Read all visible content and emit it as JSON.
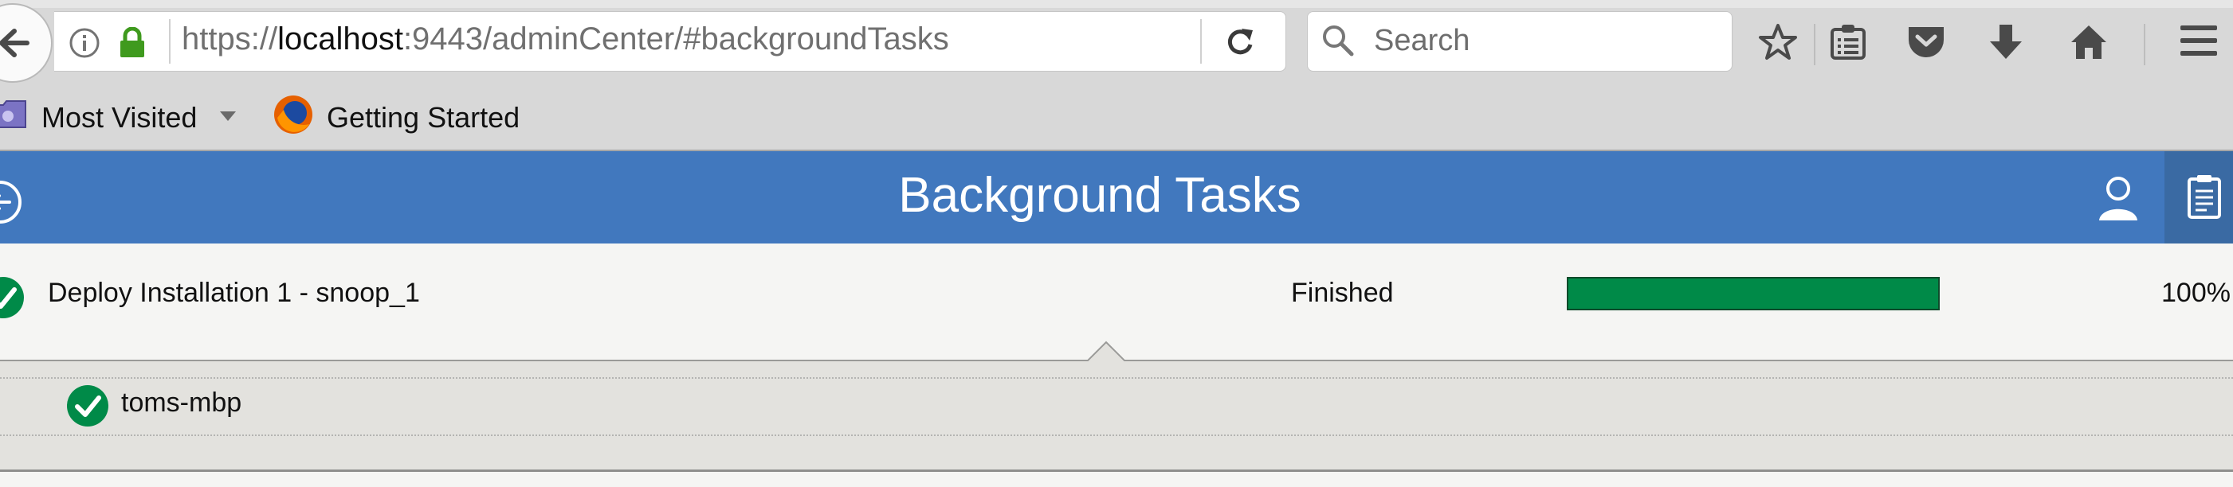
{
  "browser": {
    "url": {
      "scheme": "https://",
      "host": "localhost",
      "rest": ":9443/adminCenter/#backgroundTasks"
    },
    "search": {
      "placeholder": "Search"
    },
    "bookmarks": [
      {
        "label": "Most Visited",
        "icon": "folder-icon",
        "has_dropdown": true
      },
      {
        "label": "Getting Started",
        "icon": "firefox-icon"
      }
    ],
    "toolbar_icons": [
      "star-icon",
      "reading-list-icon",
      "pocket-icon",
      "download-icon",
      "home-icon",
      "menu-icon"
    ]
  },
  "app": {
    "title": "Background Tasks",
    "header_color": "#4178be",
    "icons": [
      "back-icon",
      "user-icon",
      "clipboard-icon"
    ]
  },
  "tasks": [
    {
      "name": "Deploy Installation 1 - snoop_1",
      "status": "Finished",
      "progress": 1.0,
      "percent": "100%",
      "status_color": "#008a48",
      "hosts": [
        {
          "name": "toms-mbp",
          "status": "success"
        }
      ]
    }
  ]
}
